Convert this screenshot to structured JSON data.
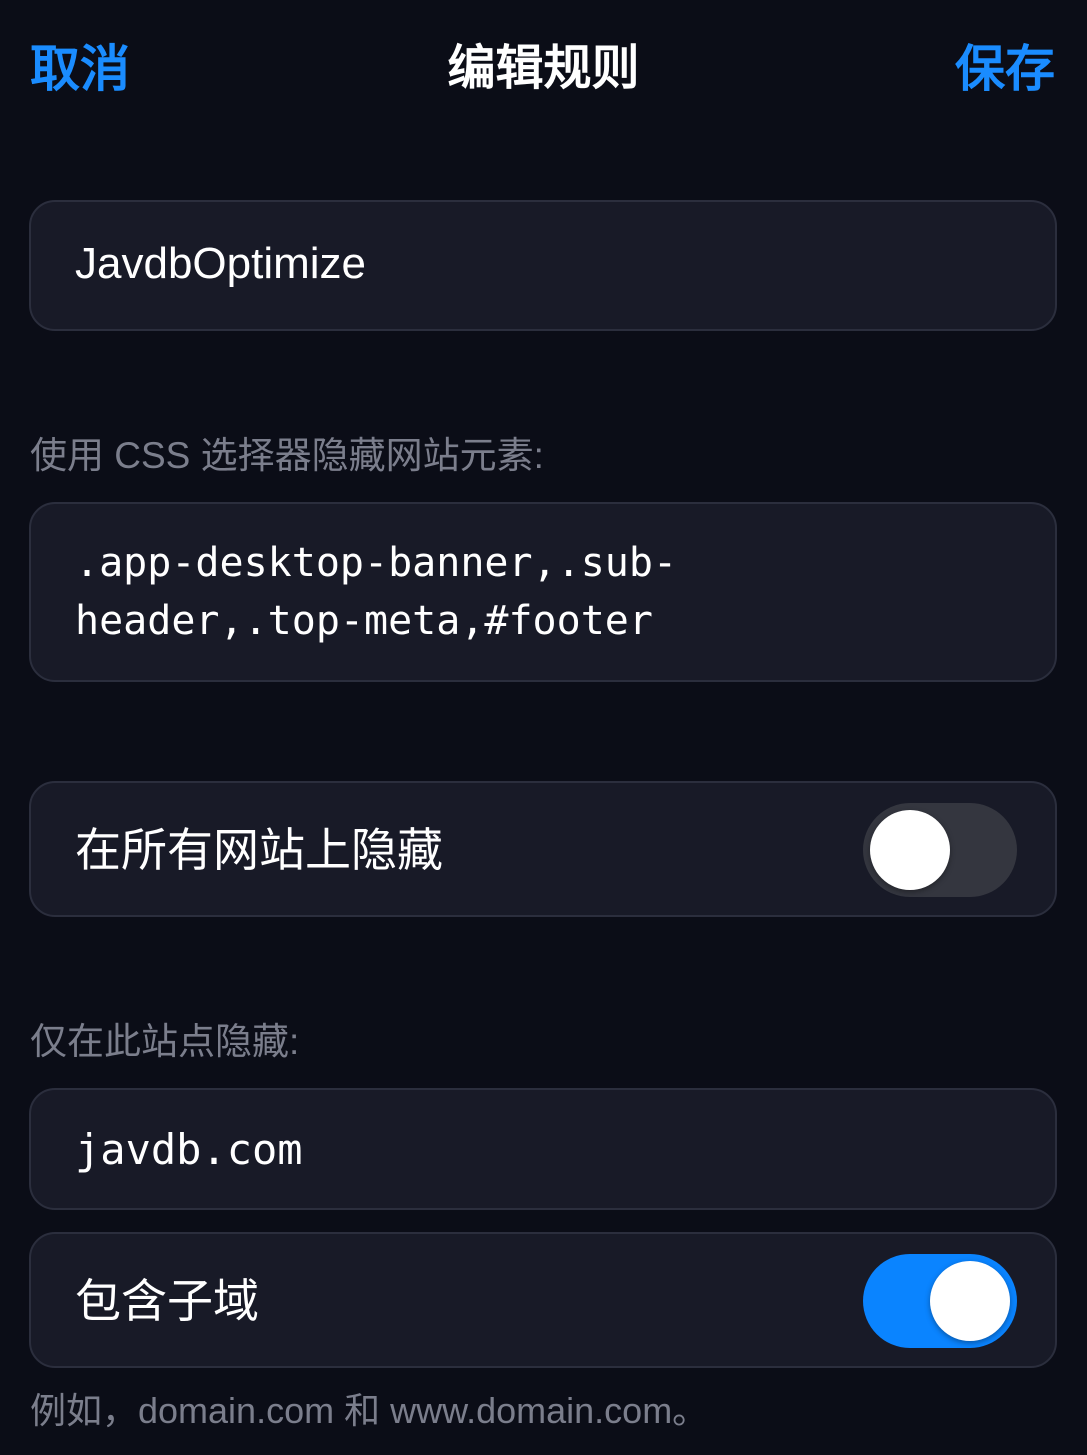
{
  "nav": {
    "cancel_label": "取消",
    "title": "编辑规则",
    "save_label": "保存"
  },
  "rule": {
    "name": "JavdbOptimize"
  },
  "css_section": {
    "label": "使用 CSS 选择器隐藏网站元素:",
    "selectors": ".app-desktop-banner,.sub-header,.top-meta,#footer"
  },
  "hide_all": {
    "label": "在所有网站上隐藏",
    "enabled": false
  },
  "site_section": {
    "label": "仅在此站点隐藏:",
    "domain": "javdb.com"
  },
  "subdomains": {
    "label": "包含子域",
    "enabled": true
  },
  "footnote": "例如，domain.com 和 www.domain.com。",
  "colors": {
    "accent": "#1a8cff",
    "background": "#0b0d17",
    "card": "#181a27",
    "switch_on": "#0a84ff",
    "switch_off": "#34363f"
  }
}
